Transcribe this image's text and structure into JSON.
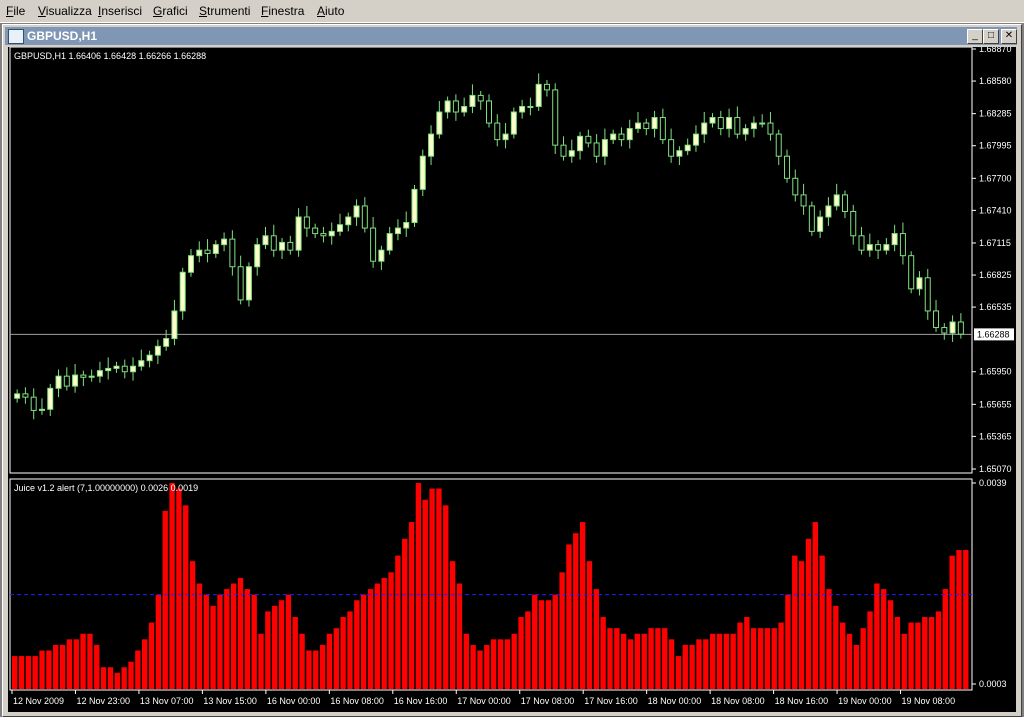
{
  "menu": [
    "File",
    "Visualizza",
    "Inserisci",
    "Grafici",
    "Strumenti",
    "Finestra",
    "Aiuto"
  ],
  "window": {
    "title": "GBPUSD,H1",
    "min_glyph": "_",
    "max_glyph": "□",
    "close_glyph": "✕"
  },
  "colors": {
    "background": "#000000",
    "bull": "#ffffcc",
    "bull_outline": "#80e080",
    "wick": "#80e080",
    "bar": "#ff0000",
    "level": "#2020ff",
    "price_line": "#a0a0a0",
    "axis_text": "#ffffff"
  },
  "chart_data": [
    {
      "type": "candlestick",
      "header": "GBPUSD,H1  1.66406 1.66428 1.66266 1.66288",
      "y_ticks": [
        "1.68870",
        "1.68580",
        "1.68285",
        "1.67995",
        "1.67700",
        "1.67410",
        "1.67115",
        "1.66825",
        "1.66535",
        "1.66288",
        "1.65950",
        "1.65655",
        "1.65365",
        "1.65070"
      ],
      "ylim": [
        1.6507,
        1.6887
      ],
      "current_price": 1.66288,
      "current_label": "1.66288",
      "closes": [
        1.6575,
        1.6572,
        1.656,
        1.6561,
        1.658,
        1.6591,
        1.6582,
        1.6592,
        1.659,
        1.6591,
        1.6596,
        1.6598,
        1.66,
        1.6595,
        1.66,
        1.6605,
        1.661,
        1.6618,
        1.6625,
        1.665,
        1.6685,
        1.67,
        1.6705,
        1.6702,
        1.671,
        1.6715,
        1.669,
        1.666,
        1.669,
        1.671,
        1.6718,
        1.6705,
        1.6712,
        1.6705,
        1.6735,
        1.6725,
        1.672,
        1.6718,
        1.6722,
        1.6728,
        1.6735,
        1.6745,
        1.6725,
        1.6695,
        1.6705,
        1.672,
        1.6725,
        1.673,
        1.676,
        1.679,
        1.681,
        1.683,
        1.684,
        1.683,
        1.6835,
        1.6845,
        1.684,
        1.682,
        1.6805,
        1.681,
        1.683,
        1.6835,
        1.6835,
        1.6855,
        1.685,
        1.68,
        1.679,
        1.6795,
        1.6808,
        1.6802,
        1.679,
        1.6805,
        1.681,
        1.6805,
        1.6815,
        1.682,
        1.6815,
        1.6825,
        1.6805,
        1.679,
        1.6795,
        1.68,
        1.681,
        1.682,
        1.6825,
        1.6815,
        1.6825,
        1.681,
        1.6815,
        1.682,
        1.682,
        1.681,
        1.679,
        1.677,
        1.6755,
        1.6745,
        1.6722,
        1.6735,
        1.6745,
        1.6755,
        1.674,
        1.6718,
        1.6705,
        1.671,
        1.6705,
        1.671,
        1.672,
        1.67,
        1.667,
        1.668,
        1.665,
        1.6635,
        1.663,
        1.664,
        1.6629
      ],
      "opens_offset": "previous_close"
    },
    {
      "type": "bar",
      "header": "Juice v1.2 alert (7,1.00000000) 0.0026 0.0019",
      "y_ticks": [
        "0.0039",
        "0.0003"
      ],
      "ylim": [
        0.0003,
        0.0039
      ],
      "level": 0.0019,
      "values": [
        0.0008,
        0.0008,
        0.0008,
        0.0008,
        0.0009,
        0.0009,
        0.001,
        0.001,
        0.0011,
        0.0011,
        0.0012,
        0.0012,
        0.001,
        0.0006,
        0.0006,
        0.0005,
        0.0006,
        0.0007,
        0.0009,
        0.0011,
        0.0014,
        0.0019,
        0.0034,
        0.0039,
        0.0038,
        0.0035,
        0.0025,
        0.0021,
        0.0019,
        0.0017,
        0.0019,
        0.002,
        0.0021,
        0.0022,
        0.002,
        0.0019,
        0.0012,
        0.0016,
        0.0017,
        0.0018,
        0.0019,
        0.0015,
        0.0012,
        0.0009,
        0.0009,
        0.001,
        0.0012,
        0.0013,
        0.0015,
        0.0016,
        0.0018,
        0.0019,
        0.002,
        0.0021,
        0.0022,
        0.0023,
        0.0026,
        0.0029,
        0.0032,
        0.0039,
        0.0036,
        0.0038,
        0.0038,
        0.0035,
        0.0025,
        0.0021,
        0.0012,
        0.001,
        0.0009,
        0.001,
        0.0011,
        0.0011,
        0.0011,
        0.0012,
        0.0015,
        0.0016,
        0.0019,
        0.0018,
        0.0018,
        0.0019,
        0.0023,
        0.0028,
        0.003,
        0.0032,
        0.0025,
        0.002,
        0.0015,
        0.0013,
        0.0013,
        0.0012,
        0.0011,
        0.0012,
        0.0012,
        0.0013,
        0.0013,
        0.0013,
        0.0011,
        0.0008,
        0.001,
        0.001,
        0.0011,
        0.0011,
        0.0012,
        0.0012,
        0.0012,
        0.0012,
        0.0014,
        0.0015,
        0.0013,
        0.0013,
        0.0013,
        0.0013,
        0.0014,
        0.0019,
        0.0026,
        0.0025,
        0.0029,
        0.0032,
        0.0026,
        0.002,
        0.0017,
        0.0014,
        0.0012,
        0.001,
        0.0013,
        0.0016,
        0.0021,
        0.002,
        0.0018,
        0.0015,
        0.0012,
        0.0014,
        0.0014,
        0.0015,
        0.0015,
        0.0016,
        0.002,
        0.0026,
        0.0027,
        0.0027
      ],
      "x_ticks": [
        "12 Nov 2009",
        "12 Nov 23:00",
        "13 Nov 07:00",
        "13 Nov 15:00",
        "16 Nov 00:00",
        "16 Nov 08:00",
        "16 Nov 16:00",
        "17 Nov 00:00",
        "17 Nov 08:00",
        "17 Nov 16:00",
        "18 Nov 00:00",
        "18 Nov 08:00",
        "18 Nov 16:00",
        "19 Nov 00:00",
        "19 Nov 08:00"
      ]
    }
  ]
}
